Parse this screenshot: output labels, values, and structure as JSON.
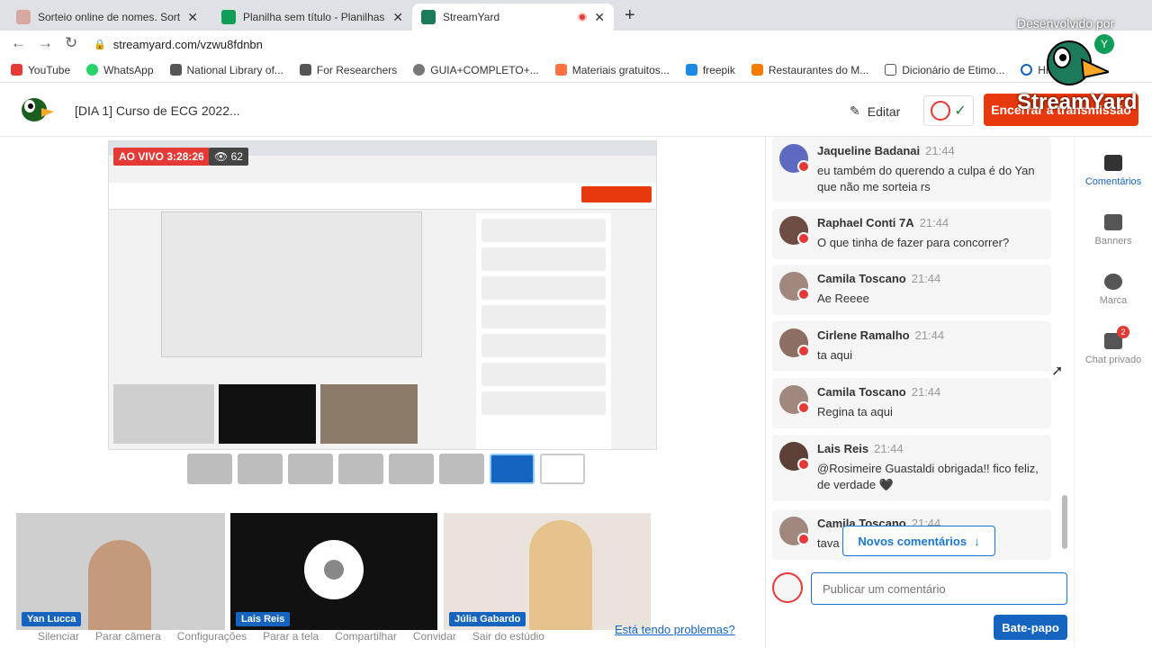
{
  "browser": {
    "tabs": [
      {
        "title": "Sorteio online de nomes. Sortear",
        "close": "✕"
      },
      {
        "title": "Planilha sem título - Planilhas Go",
        "close": "✕"
      },
      {
        "title": "StreamYard",
        "close": "✕"
      }
    ],
    "new_tab": "+",
    "url": "streamyard.com/vzwu8fdnbn",
    "watermark": "Desenvolvido por",
    "watermark_brand": "StreamYard",
    "bookmarks": [
      "YouTube",
      "WhatsApp",
      "National Library of...",
      "For Researchers",
      "GUIA+COMPLETO+...",
      "Materiais gratuitos...",
      "freepik",
      "Restaurantes do M...",
      "Dicionário de Etimo...",
      "Histórico"
    ]
  },
  "header": {
    "title": "[DIA 1] Curso de ECG 2022...",
    "edit_label": "Editar",
    "end_button": "Encerrar a transmissão"
  },
  "stage": {
    "live_label": "AO VIVO 3:28:26",
    "viewers": "62"
  },
  "participants": [
    {
      "name": "Yan Lucca"
    },
    {
      "name": "Lais Reis"
    },
    {
      "name": "Júlia Gabardo"
    }
  ],
  "bottom_bar": [
    "Silenciar",
    "Parar câmera",
    "Configurações",
    "Parar a tela",
    "Compartilhar",
    "Convidar",
    "Sair do estúdio"
  ],
  "trouble_link": "Está tendo problemas?",
  "chat": {
    "messages": [
      {
        "author": "Jaqueline Badanai",
        "time": "21:44",
        "text": "eu também do querendo a culpa é do Yan que não me sorteia rs",
        "color": "#5c6bc0"
      },
      {
        "author": "Raphael Conti 7A",
        "time": "21:44",
        "text": "O que tinha de fazer para concorrer?",
        "color": "#6d4c41"
      },
      {
        "author": "Camila Toscano",
        "time": "21:44",
        "text": "Ae Reeee",
        "color": "#a1887f"
      },
      {
        "author": "Cirlene Ramalho",
        "time": "21:44",
        "text": "ta aqui",
        "color": "#8d6e63"
      },
      {
        "author": "Camila Toscano",
        "time": "21:44",
        "text": "Regina ta aqui",
        "color": "#a1887f"
      },
      {
        "author": "Lais Reis",
        "time": "21:44",
        "text": "@Rosimeire Guastaldi obrigada!! fico feliz, de verdade 🖤",
        "color": "#5d4037"
      },
      {
        "author": "Camila Toscano",
        "time": "21:44",
        "text": "tava",
        "color": "#a1887f"
      }
    ],
    "new_comments": "Novos comentários",
    "input_placeholder": "Publicar um comentário",
    "chat_button": "Bate-papo"
  },
  "rail": [
    {
      "label": "Comentários",
      "active": true
    },
    {
      "label": "Banners"
    },
    {
      "label": "Marca"
    },
    {
      "label": "Chat privado",
      "badge": "2"
    }
  ],
  "colors": {
    "accent": "#1565c0",
    "danger": "#e8380d"
  }
}
